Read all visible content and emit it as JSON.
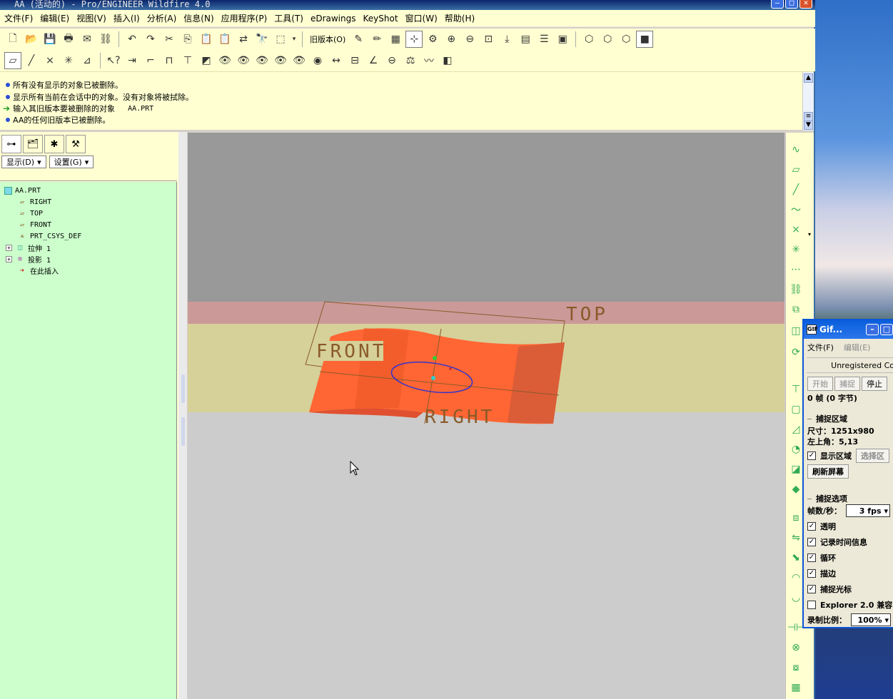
{
  "window": {
    "title": "AA (活动的) - Pro/ENGINEER Wildfire 4.0"
  },
  "menu": [
    "文件(F)",
    "编辑(E)",
    "视图(V)",
    "插入(I)",
    "分析(A)",
    "信息(N)",
    "应用程序(P)",
    "工具(T)",
    "eDrawings",
    "KeyShot",
    "窗口(W)",
    "帮助(H)"
  ],
  "toolbar": {
    "old_version_label": "旧版本(O)"
  },
  "messages": [
    {
      "type": "info",
      "text": "所有没有显示的对象已被删除。"
    },
    {
      "type": "info",
      "text": "显示所有当前在会话中的对象。没有对象将被拭除。"
    },
    {
      "type": "prompt",
      "text": "输入其旧版本要被删除的对象",
      "value": "AA.PRT"
    },
    {
      "type": "info",
      "text": "AA的任何旧版本已被删除。"
    }
  ],
  "navigator": {
    "show_btn": "显示(D)",
    "settings_btn": "设置(G)",
    "tree": [
      {
        "label": "AA.PRT",
        "icon": "part-icon",
        "level": 0,
        "expander": false
      },
      {
        "label": "RIGHT",
        "icon": "datum-plane-icon",
        "level": 1,
        "expander": false
      },
      {
        "label": "TOP",
        "icon": "datum-plane-icon",
        "level": 1,
        "expander": false
      },
      {
        "label": "FRONT",
        "icon": "datum-plane-icon",
        "level": 1,
        "expander": false
      },
      {
        "label": "PRT_CSYS_DEF",
        "icon": "csys-icon",
        "level": 1,
        "expander": false
      },
      {
        "label": "拉伸 1",
        "icon": "extrude-icon",
        "level": 1,
        "expander": true
      },
      {
        "label": "投影 1",
        "icon": "project-icon",
        "level": 1,
        "expander": true
      },
      {
        "label": "在此插入",
        "icon": "insert-here-icon",
        "level": 1,
        "expander": false
      }
    ]
  },
  "viewport": {
    "plane_labels": {
      "top": "TOP",
      "front": "FRONT",
      "right": "RIGHT"
    },
    "colors": {
      "surface": "#ff6633",
      "top_band": "#cc9999",
      "mid_band": "#d6d099",
      "upper_bg": "#999999",
      "lower_bg": "#cccccc",
      "datum": "#8a5a2a",
      "curve": "#3333cc"
    }
  },
  "gifcam": {
    "title": "Gif...",
    "menu_file": "文件(F)",
    "menu_edit": "编辑(E)",
    "unregistered": "Unregistered Cop",
    "btn_start": "开始",
    "btn_capture": "捕捉",
    "btn_stop": "停止",
    "frames": "0 帧 (0 字节)",
    "capture_region_group": "捕捉区域",
    "size_label": "尺寸：1251x980",
    "topleft_label": "左上角：5,13",
    "show_region": "显示区域",
    "select_region": "选择区",
    "refresh": "刷新屏幕",
    "capture_options_group": "捕捉选项",
    "fps_label": "帧数/秒：",
    "fps_value": "3 fps",
    "opt_transparent": "透明",
    "opt_timestamp": "记录时间信息",
    "opt_loop": "循环",
    "opt_border": "描边",
    "opt_cursor": "捕捉光标",
    "opt_explorer": "Explorer 2.0 兼容",
    "scale_label": "录制比例：",
    "scale_value": "100%"
  }
}
